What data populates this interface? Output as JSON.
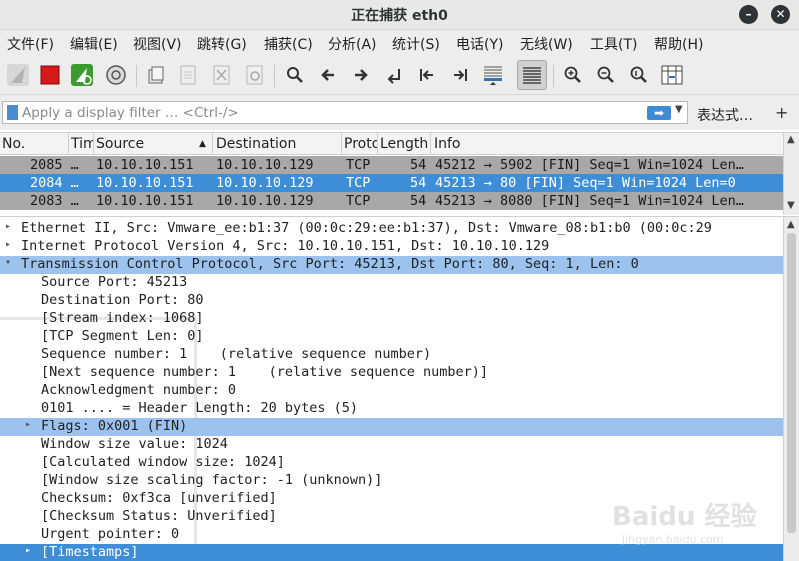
{
  "window": {
    "title": "正在捕获 eth0",
    "minimize_label": "–",
    "close_label": "✕"
  },
  "menu": [
    "文件(F)",
    "编辑(E)",
    "视图(V)",
    "跳转(G)",
    "捕获(C)",
    "分析(A)",
    "统计(S)",
    "电话(Y)",
    "无线(W)",
    "工具(T)",
    "帮助(H)"
  ],
  "toolbar": {
    "icons": [
      "shark-fin-start-icon",
      "stop-capture-icon",
      "restart-capture-icon",
      "capture-options-icon",
      "open-file-icon",
      "save-file-icon",
      "close-file-icon",
      "reload-file-icon",
      "find-packet-icon",
      "go-back-icon",
      "go-forward-icon",
      "go-to-packet-icon",
      "go-first-packet-icon",
      "go-last-packet-icon",
      "auto-scroll-icon",
      "colorize-icon",
      "zoom-in-icon",
      "zoom-out-icon",
      "zoom-normal-icon",
      "resize-columns-icon"
    ]
  },
  "filter": {
    "placeholder": "Apply a display filter … <Ctrl-/>",
    "value": "",
    "apply_label": "➡",
    "expression_label": "表达式…",
    "add_label": "+"
  },
  "packet_list": {
    "columns": [
      "No.",
      "Time",
      "Source",
      "Destination",
      "Protocol",
      "Length",
      "Info"
    ],
    "rows": [
      {
        "no": "2085 …",
        "source": "10.10.10.151",
        "destination": "10.10.10.129",
        "protocol": "TCP",
        "length": "54",
        "info": "45212 → 5902 [FIN] Seq=1 Win=1024 Len…",
        "state": "gray"
      },
      {
        "no": "2084 …",
        "source": "10.10.10.151",
        "destination": "10.10.10.129",
        "protocol": "TCP",
        "length": "54",
        "info": "45213 → 80 [FIN] Seq=1 Win=1024 Len=0",
        "state": "selected"
      },
      {
        "no": "2083 …",
        "source": "10.10.10.151",
        "destination": "10.10.10.129",
        "protocol": "TCP",
        "length": "54",
        "info": "45213 → 8080 [FIN] Seq=1 Win=1024 Len…",
        "state": "gray"
      }
    ]
  },
  "details": {
    "lines": [
      {
        "text": "Ethernet II, Src: Vmware_ee:b1:37 (00:0c:29:ee:b1:37), Dst: Vmware_08:b1:b0 (00:0c:29",
        "arrow": "▸",
        "state": ""
      },
      {
        "text": "Internet Protocol Version 4, Src: 10.10.10.151, Dst: 10.10.10.129",
        "arrow": "▸",
        "state": ""
      },
      {
        "text": "Transmission Control Protocol, Src Port: 45213, Dst Port: 80, Seq: 1, Len: 0",
        "arrow": "▾",
        "state": "highlight"
      },
      {
        "text": "Source Port: 45213",
        "arrow": "",
        "state": ""
      },
      {
        "text": "Destination Port: 80",
        "arrow": "",
        "state": ""
      },
      {
        "text": "[Stream index: 1068]",
        "arrow": "",
        "state": ""
      },
      {
        "text": "[TCP Segment Len: 0]",
        "arrow": "",
        "state": ""
      },
      {
        "text": "Sequence number: 1    (relative sequence number)",
        "arrow": "",
        "state": ""
      },
      {
        "text": "[Next sequence number: 1    (relative sequence number)]",
        "arrow": "",
        "state": ""
      },
      {
        "text": "Acknowledgment number: 0",
        "arrow": "",
        "state": ""
      },
      {
        "text": "0101 .... = Header Length: 20 bytes (5)",
        "arrow": "",
        "state": ""
      },
      {
        "text": "Flags: 0x001 (FIN)",
        "arrow": "▸",
        "state": "highlight"
      },
      {
        "text": "Window size value: 1024",
        "arrow": "",
        "state": ""
      },
      {
        "text": "[Calculated window size: 1024]",
        "arrow": "",
        "state": ""
      },
      {
        "text": "[Window size scaling factor: -1 (unknown)]",
        "arrow": "",
        "state": ""
      },
      {
        "text": "Checksum: 0xf3ca [unverified]",
        "arrow": "",
        "state": ""
      },
      {
        "text": "[Checksum Status: Unverified]",
        "arrow": "",
        "state": ""
      },
      {
        "text": "Urgent pointer: 0",
        "arrow": "",
        "state": ""
      },
      {
        "text": "[Timestamps]",
        "arrow": "▸",
        "state": "selected"
      }
    ]
  },
  "watermark": {
    "brand": "Baidu 经验",
    "url": "jingyan.baidu.com"
  },
  "colors": {
    "selection": "#3d8ed6",
    "highlight": "#9cc3ee",
    "stop_red": "#d7191b",
    "restart_green": "#3a9b2e"
  }
}
